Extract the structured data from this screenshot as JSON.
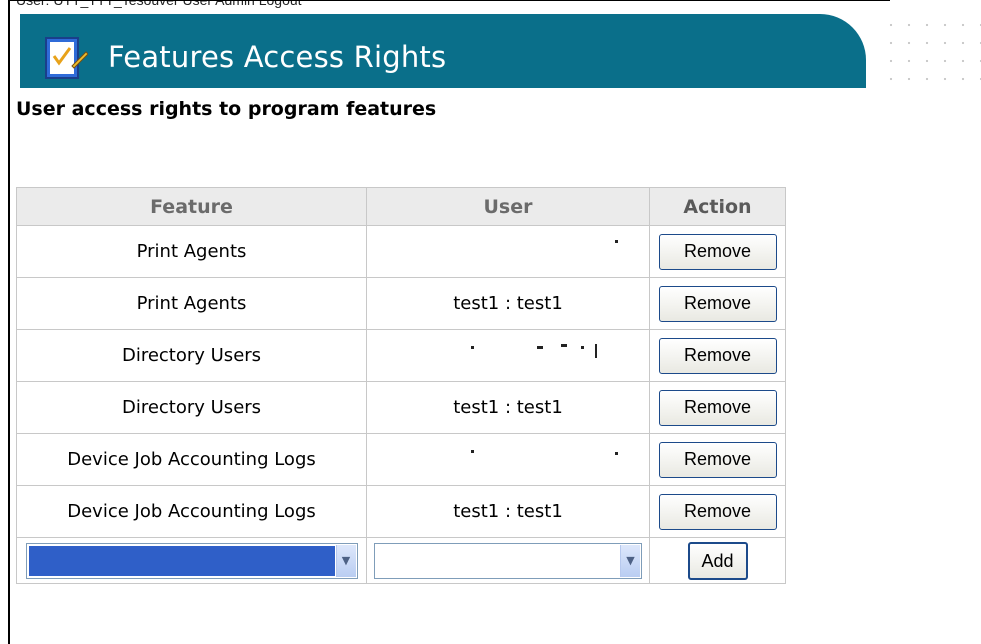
{
  "header": {
    "title": "Features Access Rights",
    "banner_color": "#0a6f8a",
    "icon": "checklist-pen-icon"
  },
  "topbar_cut_text": "User: UTT_TTT_Tesouver     User Admin      Logout",
  "subtitle": "User access rights to program features",
  "table": {
    "headers": {
      "feature": "Feature",
      "user": "User",
      "action": "Action"
    },
    "rows": [
      {
        "feature": "Print Agents",
        "user": "",
        "action": "Remove"
      },
      {
        "feature": "Print Agents",
        "user": "test1 : test1",
        "action": "Remove"
      },
      {
        "feature": "Directory Users",
        "user": "",
        "action": "Remove"
      },
      {
        "feature": "Directory Users",
        "user": "test1 : test1",
        "action": "Remove"
      },
      {
        "feature": "Device Job Accounting Logs",
        "user": "",
        "action": "Remove"
      },
      {
        "feature": "Device Job Accounting Logs",
        "user": "test1 : test1",
        "action": "Remove"
      }
    ],
    "add_row": {
      "feature_select_value": "",
      "user_select_value": "",
      "add_label": "Add"
    }
  }
}
